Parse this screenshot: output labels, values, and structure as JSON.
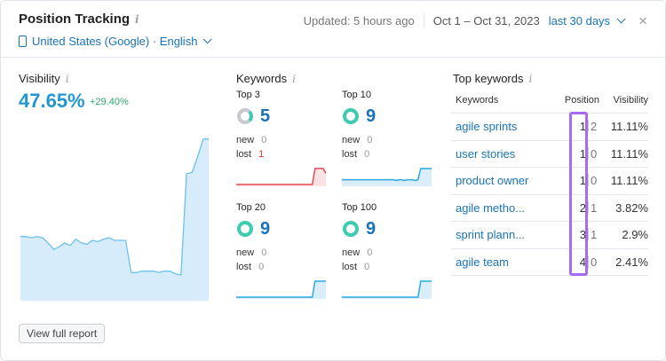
{
  "header": {
    "title": "Position Tracking",
    "info_icon": "i",
    "location": "United States (Google) · English",
    "updated": "Updated: 5 hours ago",
    "date_range": "Oct 1 – Oct 31, 2023",
    "period": "last 30 days",
    "close_icon": "×"
  },
  "visibility": {
    "label": "Visibility",
    "value": "47.65%",
    "delta": "+29.40%",
    "series": [
      50,
      50,
      49,
      50,
      49,
      45,
      40,
      42,
      45,
      43,
      48,
      45,
      44,
      47,
      46,
      48,
      49,
      47,
      47,
      47,
      22,
      22,
      23,
      23,
      23,
      22,
      23,
      23,
      21,
      20,
      99,
      100,
      112,
      126,
      126
    ]
  },
  "keywords": {
    "label": "Keywords",
    "blocks": [
      {
        "title": "Top 3",
        "value": "5",
        "new_label": "new",
        "new": "0",
        "lost_label": "lost",
        "lost": "1",
        "ring_color": "#c7c9cc",
        "line_color": "#e24b56",
        "fill_color": "#fbe3e5",
        "series": [
          0,
          0,
          0,
          0,
          0,
          0,
          0,
          0,
          0,
          0,
          0,
          0,
          0,
          0,
          0,
          0,
          0,
          0,
          0,
          0,
          0,
          0,
          0,
          0,
          0,
          0,
          0,
          0,
          0,
          1,
          1,
          1,
          1,
          0.7
        ]
      },
      {
        "title": "Top 10",
        "value": "9",
        "new_label": "new",
        "new": "0",
        "lost_label": "lost",
        "lost": "0",
        "ring_color": "#3ecbb0",
        "line_color": "#2ba9e0",
        "fill_color": "#d9eefa",
        "series": [
          0.3,
          0.3,
          0.3,
          0.3,
          0.3,
          0.3,
          0.3,
          0.3,
          0.3,
          0.3,
          0.3,
          0.3,
          0.3,
          0.3,
          0.3,
          0.3,
          0.3,
          0.3,
          0.3,
          0.3,
          0.25,
          0.3,
          0.3,
          0.25,
          0.3,
          0.3,
          0.3,
          0.25,
          0.3,
          1,
          1,
          1,
          1,
          1
        ]
      },
      {
        "title": "Top 20",
        "value": "9",
        "new_label": "new",
        "new": "0",
        "lost_label": "lost",
        "lost": "0",
        "ring_color": "#3ecbb0",
        "line_color": "#2ba9e0",
        "fill_color": "#d9eefa",
        "series": [
          0,
          0,
          0,
          0,
          0,
          0,
          0,
          0,
          0,
          0,
          0,
          0,
          0,
          0,
          0,
          0,
          0,
          0,
          0,
          0,
          0,
          0,
          0,
          0,
          0,
          0,
          0,
          0,
          0,
          1,
          1,
          1,
          1,
          1
        ]
      },
      {
        "title": "Top 100",
        "value": "9",
        "new_label": "new",
        "new": "0",
        "lost_label": "lost",
        "lost": "0",
        "ring_color": "#3ecbb0",
        "line_color": "#2ba9e0",
        "fill_color": "#d9eefa",
        "series": [
          0,
          0,
          0,
          0,
          0,
          0,
          0,
          0,
          0,
          0,
          0,
          0,
          0,
          0,
          0,
          0,
          0,
          0,
          0,
          0,
          0,
          0,
          0,
          0,
          0,
          0,
          0,
          0,
          0,
          1,
          1,
          1,
          1,
          1
        ]
      }
    ]
  },
  "top_keywords": {
    "label": "Top keywords",
    "columns": [
      "Keywords",
      "Position",
      "Visibility"
    ],
    "rows": [
      {
        "keyword": "agile sprints",
        "pos": "1",
        "change": "2",
        "vis": "11.11%"
      },
      {
        "keyword": "user stories",
        "pos": "1",
        "change": "0",
        "vis": "11.11%"
      },
      {
        "keyword": "product owner",
        "pos": "1",
        "change": "0",
        "vis": "11.11%"
      },
      {
        "keyword": "agile metho...",
        "pos": "2",
        "change": "1",
        "vis": "3.82%"
      },
      {
        "keyword": "sprint plann...",
        "pos": "3",
        "change": "1",
        "vis": "2.9%"
      },
      {
        "keyword": "agile team",
        "pos": "4",
        "change": "0",
        "vis": "2.41%"
      }
    ]
  },
  "footer": {
    "button": "View full report"
  },
  "colors": {
    "accent": "#1a73b8",
    "visibility": "#2196d3",
    "highlight": "#a86af0"
  }
}
